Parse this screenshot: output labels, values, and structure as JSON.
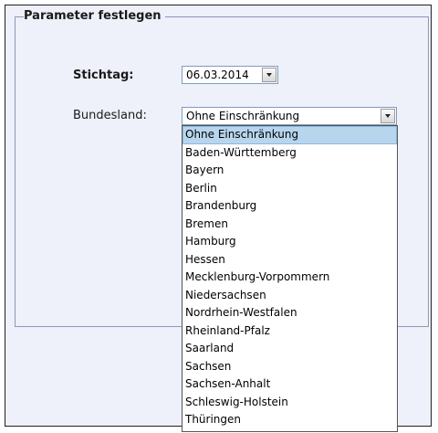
{
  "form": {
    "legend": "Parameter festlegen",
    "stichtag_label": "Stichtag:",
    "stichtag_value": "06.03.2014",
    "bundesland_label": "Bundesland:",
    "bundesland_value": "Ohne Einschränkung"
  },
  "dropdown": {
    "options": [
      "Ohne Einschränkung",
      "Baden-Württemberg",
      "Bayern",
      "Berlin",
      "Brandenburg",
      "Bremen",
      "Hamburg",
      "Hessen",
      "Mecklenburg-Vorpommern",
      "Niedersachsen",
      "Nordrhein-Westfalen",
      "Rheinland-Pfalz",
      "Saarland",
      "Sachsen",
      "Sachsen-Anhalt",
      "Schleswig-Holstein",
      "Thüringen"
    ],
    "selected_index": 0
  },
  "icons": {
    "date_button": "chevron-down-icon",
    "select_button": "chevron-down-icon"
  },
  "colors": {
    "panel_background": "#eef0fa",
    "selected_option": "#b7d6ee",
    "fieldset_border": "#8c97b8"
  }
}
